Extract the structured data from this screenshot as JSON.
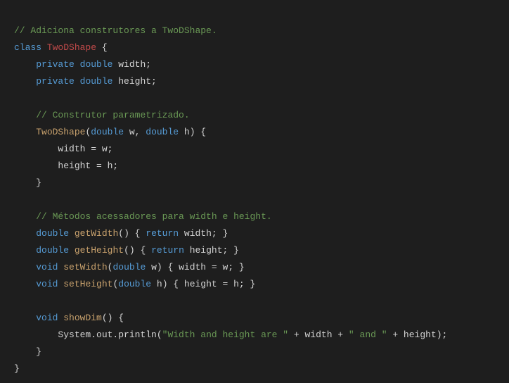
{
  "code": {
    "c1": "// Adiciona construtores a TwoDShape.",
    "kw_class": "class",
    "cls_name": "TwoDShape",
    "brace_open": " {",
    "kw_private1": "private",
    "kw_double1": "double",
    "id_width_decl": " width;",
    "kw_private2": "private",
    "kw_double2": "double",
    "id_height_decl": " height;",
    "c2": "// Construtor parametrizado.",
    "ctor_name": "TwoDShape",
    "ctor_sig_open": "(",
    "kw_double3": "double",
    "ctor_w": " w, ",
    "kw_double4": "double",
    "ctor_h": " h) {",
    "assign_w": "width = w;",
    "assign_h": "height = h;",
    "brace_close1": "}",
    "c3": "// Métodos acessadores para width e height.",
    "kw_double5": "double",
    "m_getWidth": "getWidth",
    "getWidth_body1": "() { ",
    "kw_return1": "return",
    "getWidth_body2": " width; }",
    "kw_double6": "double",
    "m_getHeight": "getHeight",
    "getHeight_body1": "() { ",
    "kw_return2": "return",
    "getHeight_body2": " height; }",
    "kw_void1": "void",
    "m_setWidth": "setWidth",
    "setWidth_sig1": "(",
    "kw_double7": "double",
    "setWidth_sig2": " w) { width = w; }",
    "kw_void2": "void",
    "m_setHeight": "setHeight",
    "setHeight_sig1": "(",
    "kw_double8": "double",
    "setHeight_sig2": " h) { height = h; }",
    "kw_void3": "void",
    "m_showDim": "showDim",
    "showDim_sig": "() {",
    "println_call": "System.out.println(",
    "str1": "\"Width and height are \"",
    "plus1": " + width + ",
    "str2": "\" and \"",
    "plus2": " + height);",
    "brace_close2": "}",
    "brace_close3": "}"
  }
}
